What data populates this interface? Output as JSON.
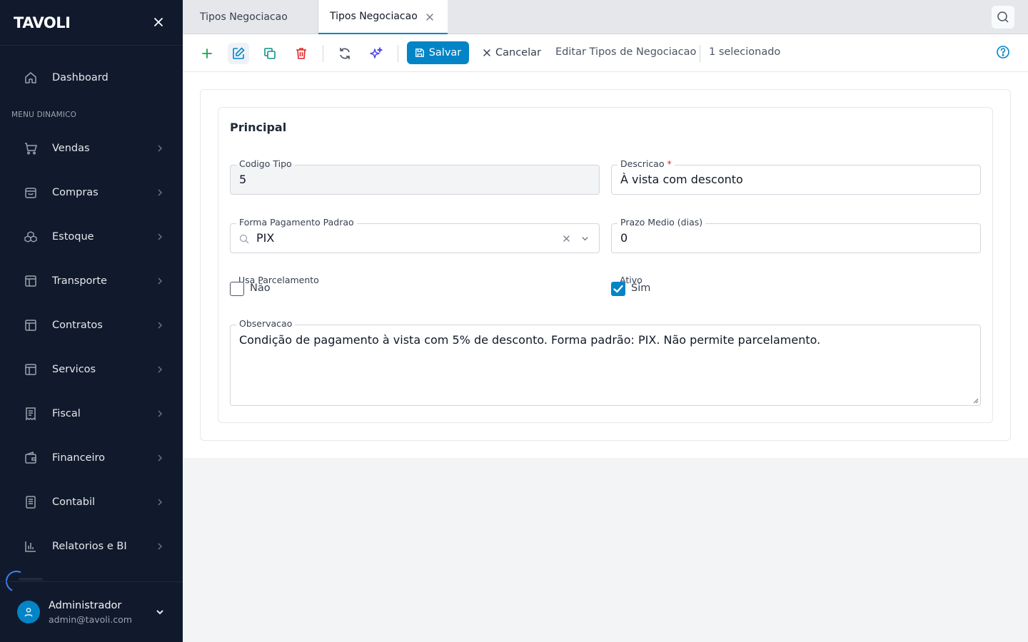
{
  "brand": "TAVOLI",
  "sidebar": {
    "dashboard_label": "Dashboard",
    "menu_heading": "MENU DINAMICO",
    "items": [
      {
        "label": "Vendas",
        "icon": "cart-icon"
      },
      {
        "label": "Compras",
        "icon": "shopping-bag-icon"
      },
      {
        "label": "Estoque",
        "icon": "boxes-icon"
      },
      {
        "label": "Transporte",
        "icon": "table-icon"
      },
      {
        "label": "Contratos",
        "icon": "table-icon"
      },
      {
        "label": "Servicos",
        "icon": "table-icon"
      },
      {
        "label": "Fiscal",
        "icon": "receipt-icon"
      },
      {
        "label": "Financeiro",
        "icon": "wallet-icon"
      },
      {
        "label": "Contabil",
        "icon": "book-icon"
      },
      {
        "label": "Relatorios e BI",
        "icon": "bar-chart-icon"
      }
    ],
    "user": {
      "name": "Administrador",
      "email": "admin@tavoli.com"
    }
  },
  "tabs": [
    {
      "label": "Tipos Negociacao",
      "active": false
    },
    {
      "label": "Tipos Negociacao",
      "active": true
    }
  ],
  "toolbar": {
    "save_label": "Salvar",
    "cancel_label": "Cancelar",
    "title": "Editar Tipos de Negociacao",
    "selection": "1 selecionado"
  },
  "form": {
    "section_title": "Principal",
    "codigo_tipo": {
      "label": "Codigo Tipo",
      "value": "5"
    },
    "descricao": {
      "label": "Descricao",
      "required_mark": "*",
      "value": "À vista com desconto"
    },
    "forma_pagamento": {
      "label": "Forma Pagamento Padrao",
      "value": "PIX"
    },
    "prazo_medio": {
      "label": "Prazo Medio (dias)",
      "value": "0"
    },
    "usa_parcelamento": {
      "label": "Usa Parcelamento",
      "checked": false,
      "text": "Não"
    },
    "ativo": {
      "label": "Ativo",
      "checked": true,
      "text": "Sim"
    },
    "observacao": {
      "label": "Observacao",
      "value": "Condição de pagamento à vista com 5% de desconto. Forma padrão: PIX. Não permite parcelamento."
    }
  },
  "colors": {
    "sidebar_bg": "#111a2c",
    "accent": "#0284c7",
    "add": "#16a34a",
    "delete": "#dc2626",
    "copy": "#0d9488",
    "ai": "#4f46e5"
  }
}
